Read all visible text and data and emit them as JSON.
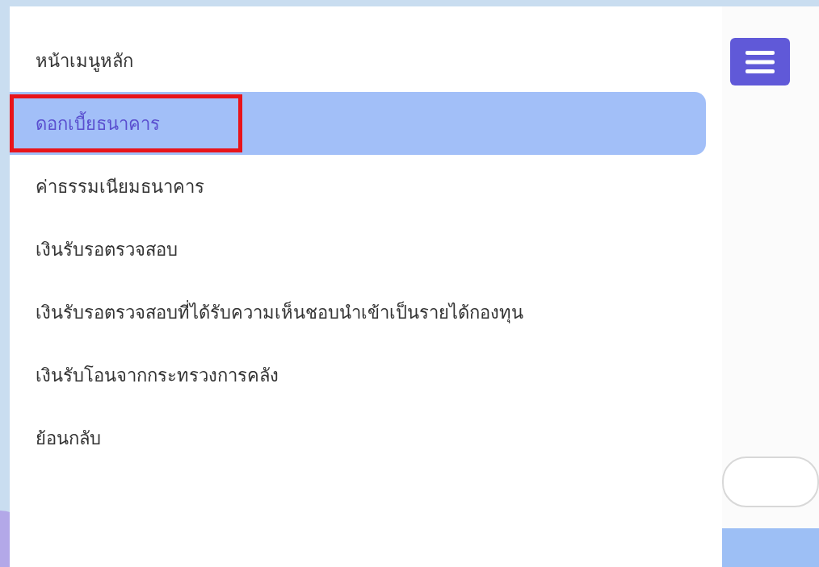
{
  "menu": {
    "items": [
      {
        "label": "หน้าเมนูหลัก",
        "selected": false,
        "marked": false
      },
      {
        "label": "ดอกเบี้ยธนาคาร",
        "selected": true,
        "marked": true
      },
      {
        "label": "ค่าธรรมเนียมธนาคาร",
        "selected": false,
        "marked": false
      },
      {
        "label": "เงินรับรอตรวจสอบ",
        "selected": false,
        "marked": false
      },
      {
        "label": "เงินรับรอตรวจสอบที่ได้รับความเห็นชอบนำเข้าเป็นรายได้กองทุน",
        "selected": false,
        "marked": false
      },
      {
        "label": "เงินรับโอนจากกระทรวงการคลัง",
        "selected": false,
        "marked": false
      },
      {
        "label": "ย้อนกลับ",
        "selected": false,
        "marked": false
      }
    ]
  }
}
